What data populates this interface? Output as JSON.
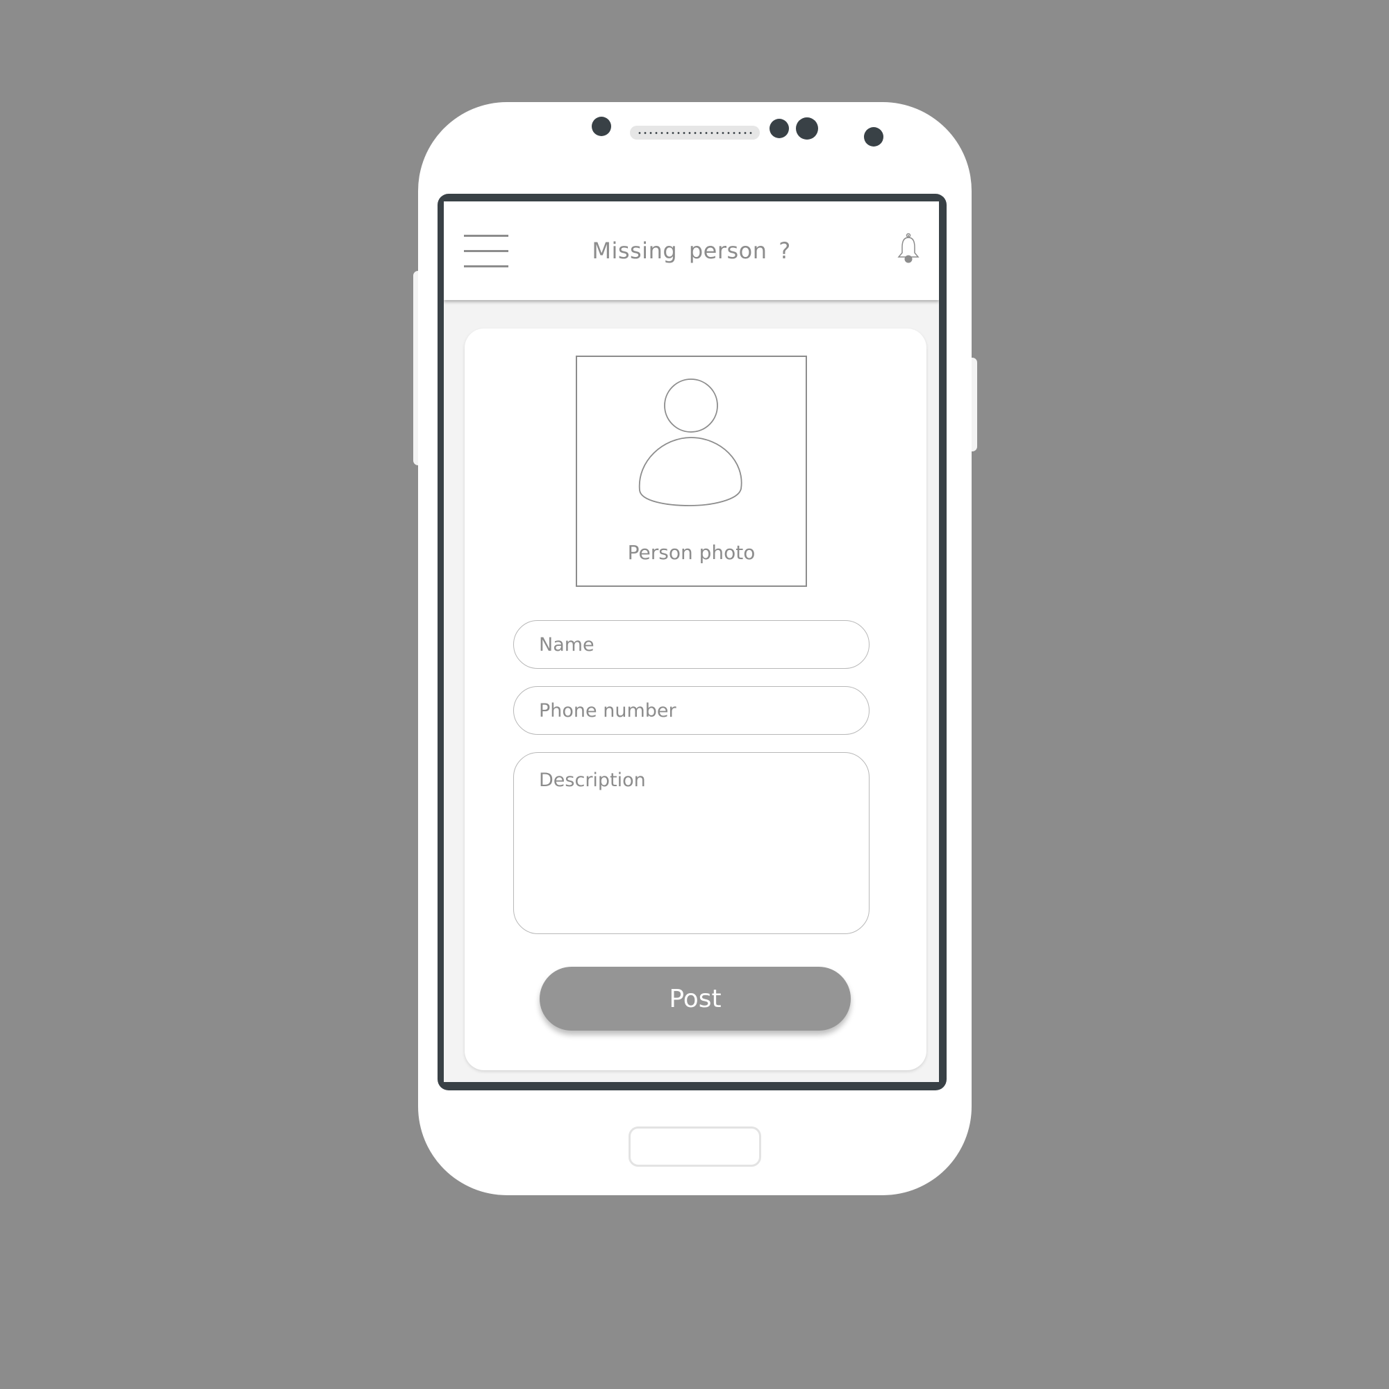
{
  "app": {
    "title": "Missing  person ?"
  },
  "header": {
    "menu_icon": "hamburger-menu-icon",
    "notification_icon": "bell-icon"
  },
  "form": {
    "photo_icon": "person-avatar-icon",
    "photo_label": "Person photo",
    "name_placeholder": "Name",
    "phone_placeholder": "Phone number",
    "description_placeholder": "Description",
    "post_label": "Post"
  },
  "colors": {
    "background": "#8c8c8c",
    "bezel": "#394146",
    "button": "#959595",
    "text_muted": "#8c8c8c"
  }
}
